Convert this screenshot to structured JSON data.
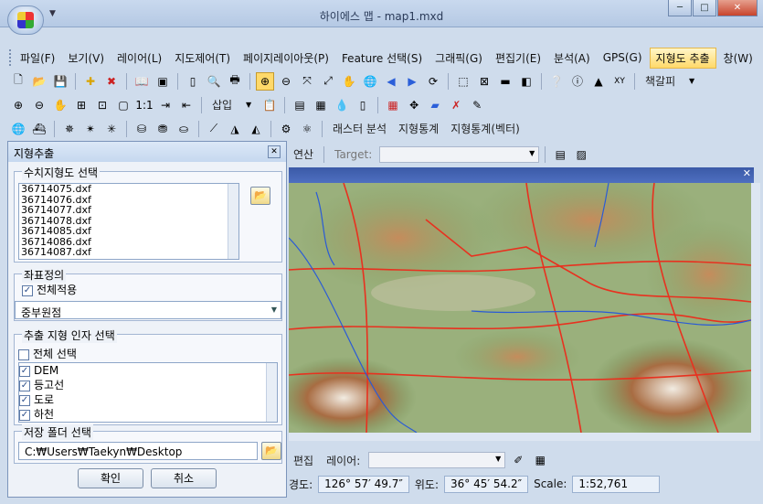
{
  "window": {
    "title": "하이에스 맵 - map1.mxd"
  },
  "menu": [
    "파일(F)",
    "보기(V)",
    "레이어(L)",
    "지도제어(T)",
    "페이지레이아웃(P)",
    "Feature 선택(S)",
    "그래픽(G)",
    "편집기(E)",
    "분석(A)",
    "GPS(G)",
    "지형도 추출",
    "창(W)"
  ],
  "toolbar2": {
    "insert": "삽입",
    "bookmark": "책갈피"
  },
  "toolbar4": {
    "raster": "래스터 분석",
    "terrain_stat": "지형통계",
    "terrain_stat_vec": "지형통계(벡터)"
  },
  "toolbar5": {
    "calc": "연산",
    "target_label": "Target:"
  },
  "panel": {
    "title": "지형추출",
    "group_files": "수치지형도 선택",
    "files": [
      "36714075.dxf",
      "36714076.dxf",
      "36714077.dxf",
      "36714078.dxf",
      "36714085.dxf",
      "36714086.dxf",
      "36714087.dxf"
    ],
    "group_coord": "좌표정의",
    "apply_all": "전체적용",
    "coord_value": "중부원점",
    "group_factor": "추출 지형 인자 선택",
    "select_all": "전체 선택",
    "factors": [
      "DEM",
      "등고선",
      "도로",
      "하천"
    ],
    "group_folder": "저장 폴더 선택",
    "folder_path": "C:₩Users₩Taekyn₩Desktop",
    "ok": "확인",
    "cancel": "취소"
  },
  "edit_row": {
    "edit": "편집",
    "layer": "레이어:"
  },
  "status": {
    "lon_label": "경도:",
    "lon": "126° 57′ 49.7″",
    "lat_label": "위도:",
    "lat": "36° 45′ 54.2″",
    "scale_label": "Scale:",
    "scale": "1:52,761"
  },
  "colors": {
    "highlight": "#ffd96a",
    "roads": "#e8311f",
    "rivers": "#2a5bd6"
  }
}
